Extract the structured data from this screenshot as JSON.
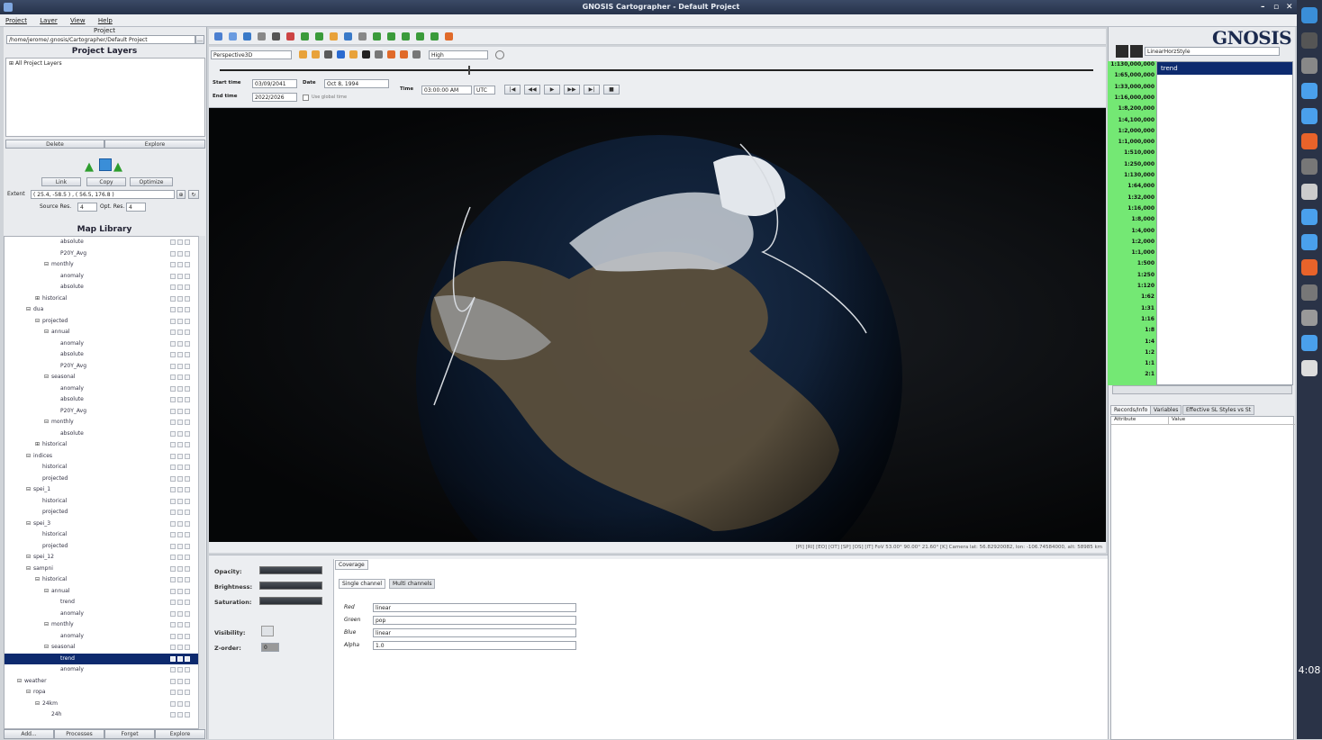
{
  "window": {
    "title": "GNOSIS Cartographer - Default Project",
    "controls": [
      "–",
      "▫",
      "✕"
    ]
  },
  "menu": [
    "Project",
    "Layer",
    "View",
    "Help"
  ],
  "project": {
    "header": "Project",
    "path": "/home/jerome/.gnosis/Cartographer/Default Project",
    "layers_title": "Project Layers",
    "all_layers": "All Project Layers",
    "delete_label": "Delete",
    "explore_label": "Explore"
  },
  "transfer": {
    "link_label": "Link",
    "copy_label": "Copy",
    "optimize_label": "Optimize",
    "extent_label": "Extent",
    "extent_value": "( 25.4, -58.5 ) , ( 56.5, 176.8 )",
    "source_res_label": "Source Res.",
    "source_res_value": "4",
    "opt_res_label": "Opt. Res.",
    "opt_res_value": "4"
  },
  "library": {
    "title": "Map Library",
    "rows": [
      {
        "label": "absolute",
        "indent": 5,
        "toggle": ""
      },
      {
        "label": "P20Y_Avg",
        "indent": 5,
        "toggle": ""
      },
      {
        "label": "monthly",
        "indent": 4,
        "toggle": "⊟"
      },
      {
        "label": "anomaly",
        "indent": 5,
        "toggle": ""
      },
      {
        "label": "absolute",
        "indent": 5,
        "toggle": ""
      },
      {
        "label": "historical",
        "indent": 3,
        "toggle": "⊞"
      },
      {
        "label": "dua",
        "indent": 2,
        "toggle": "⊟"
      },
      {
        "label": "projected",
        "indent": 3,
        "toggle": "⊟"
      },
      {
        "label": "annual",
        "indent": 4,
        "toggle": "⊟"
      },
      {
        "label": "anomaly",
        "indent": 5,
        "toggle": ""
      },
      {
        "label": "absolute",
        "indent": 5,
        "toggle": ""
      },
      {
        "label": "P20Y_Avg",
        "indent": 5,
        "toggle": ""
      },
      {
        "label": "seasonal",
        "indent": 4,
        "toggle": "⊟"
      },
      {
        "label": "anomaly",
        "indent": 5,
        "toggle": ""
      },
      {
        "label": "absolute",
        "indent": 5,
        "toggle": ""
      },
      {
        "label": "P20Y_Avg",
        "indent": 5,
        "toggle": ""
      },
      {
        "label": "monthly",
        "indent": 4,
        "toggle": "⊟"
      },
      {
        "label": "absolute",
        "indent": 5,
        "toggle": ""
      },
      {
        "label": "historical",
        "indent": 3,
        "toggle": "⊞"
      },
      {
        "label": "indices",
        "indent": 2,
        "toggle": "⊟"
      },
      {
        "label": "historical",
        "indent": 3,
        "toggle": ""
      },
      {
        "label": "projected",
        "indent": 3,
        "toggle": ""
      },
      {
        "label": "spei_1",
        "indent": 2,
        "toggle": "⊟"
      },
      {
        "label": "historical",
        "indent": 3,
        "toggle": ""
      },
      {
        "label": "projected",
        "indent": 3,
        "toggle": ""
      },
      {
        "label": "spei_3",
        "indent": 2,
        "toggle": "⊟"
      },
      {
        "label": "historical",
        "indent": 3,
        "toggle": ""
      },
      {
        "label": "projected",
        "indent": 3,
        "toggle": ""
      },
      {
        "label": "spei_12",
        "indent": 2,
        "toggle": "⊟"
      },
      {
        "label": "sampni",
        "indent": 2,
        "toggle": "⊟"
      },
      {
        "label": "historical",
        "indent": 3,
        "toggle": "⊟"
      },
      {
        "label": "annual",
        "indent": 4,
        "toggle": "⊟"
      },
      {
        "label": "trend",
        "indent": 5,
        "toggle": ""
      },
      {
        "label": "anomaly",
        "indent": 5,
        "toggle": ""
      },
      {
        "label": "monthly",
        "indent": 4,
        "toggle": "⊟"
      },
      {
        "label": "anomaly",
        "indent": 5,
        "toggle": ""
      },
      {
        "label": "seasonal",
        "indent": 4,
        "toggle": "⊟"
      },
      {
        "label": "trend",
        "indent": 5,
        "toggle": "",
        "selected": true
      },
      {
        "label": "anomaly",
        "indent": 5,
        "toggle": ""
      },
      {
        "label": "weather",
        "indent": 1,
        "toggle": "⊟"
      },
      {
        "label": "ropa",
        "indent": 2,
        "toggle": "⊟"
      },
      {
        "label": "24km",
        "indent": 3,
        "toggle": "⊟"
      },
      {
        "label": "24h",
        "indent": 4,
        "toggle": ""
      }
    ],
    "bottom_buttons": [
      "Add...",
      "Processes",
      "Forget",
      "Explore"
    ]
  },
  "viewer": {
    "mode": "Perspective3D",
    "quality": "High",
    "start_time_label": "Start time",
    "start_time_value": "03/09/2041",
    "end_time_label": "End time",
    "end_time_value": "2022/2026",
    "use_global_time": "Use global time",
    "date_label": "Date",
    "date_value": "Oct 8, 1994",
    "time_label": "Time",
    "time_value": "03:00:00 AM",
    "timezone": "UTC",
    "status": "[PI] [RI] [EO] [OT] [SP] [OS] [IT]   FoV 53.00°   90.00°   21.60° [K]   Camera   lat: 56.82920082, lon: -106.74584000, alt: 58985 km"
  },
  "properties": {
    "opacity_label": "Opacity:",
    "brightness_label": "Brightness:",
    "saturation_label": "Saturation:",
    "visibility_label": "Visibility:",
    "zorder_label": "Z-order:",
    "zorder_value": "0",
    "coverage_tab": "Coverage",
    "single_channel": "Single channel",
    "multi_channels": "Multi channels",
    "fields": [
      {
        "label": "Red",
        "value": "linear"
      },
      {
        "label": "Green",
        "value": "pop"
      },
      {
        "label": "Blue",
        "value": "linear"
      },
      {
        "label": "Alpha",
        "value": "1.0"
      }
    ]
  },
  "right": {
    "logo": "GNOSIS",
    "style_selector": "LinearHorzStyle",
    "selected_style": "trend",
    "scales": [
      "1:130,000,000",
      "1:65,000,000",
      "1:33,000,000",
      "1:16,000,000",
      "1:8,200,000",
      "1:4,100,000",
      "1:2,000,000",
      "1:1,000,000",
      "1:510,000",
      "1:250,000",
      "1:130,000",
      "1:64,000",
      "1:32,000",
      "1:16,000",
      "1:8,000",
      "1:4,000",
      "1:2,000",
      "1:1,000",
      "1:500",
      "1:250",
      "1:120",
      "1:62",
      "1:31",
      "1:16",
      "1:8",
      "1:4",
      "1:2",
      "1:1",
      "2:1"
    ],
    "tabs": [
      "Records/Info",
      "Variables",
      "Effective SL Styles vs St"
    ],
    "columns": [
      "Attribute",
      "Value"
    ]
  },
  "clock": "4:08",
  "colors": {
    "scale_green": "#74e874",
    "selection_navy": "#0d2a6e",
    "taskbar": "#2a3347"
  }
}
